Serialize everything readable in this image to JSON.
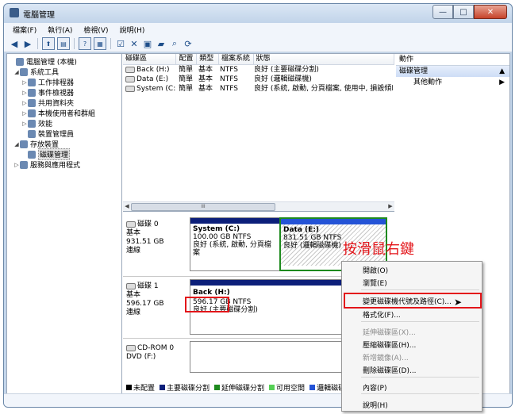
{
  "window": {
    "title": "電腦管理",
    "min": "—",
    "max": "□",
    "close": "✕"
  },
  "menu": [
    "檔案(F)",
    "執行(A)",
    "檢視(V)",
    "說明(H)"
  ],
  "tree": [
    {
      "label": "電腦管理 (本機)",
      "depth": 0,
      "exp": ""
    },
    {
      "label": "系統工具",
      "depth": 1,
      "exp": "◢"
    },
    {
      "label": "工作排程器",
      "depth": 2,
      "exp": "▷"
    },
    {
      "label": "事件檢視器",
      "depth": 2,
      "exp": "▷"
    },
    {
      "label": "共用資料夾",
      "depth": 2,
      "exp": "▷"
    },
    {
      "label": "本機使用者和群組",
      "depth": 2,
      "exp": "▷"
    },
    {
      "label": "效能",
      "depth": 2,
      "exp": "▷"
    },
    {
      "label": "裝置管理員",
      "depth": 2,
      "exp": ""
    },
    {
      "label": "存放裝置",
      "depth": 1,
      "exp": "◢"
    },
    {
      "label": "磁碟管理",
      "depth": 2,
      "exp": "",
      "selected": true
    },
    {
      "label": "服務與應用程式",
      "depth": 1,
      "exp": "▷"
    }
  ],
  "list": {
    "headers": [
      "磁碟區",
      "配置",
      "類型",
      "檔案系統",
      "狀態"
    ],
    "rows": [
      [
        "Back (H:)",
        "簡單",
        "基本",
        "NTFS",
        "良好 (主要磁碟分割)"
      ],
      [
        "Data (E:)",
        "簡單",
        "基本",
        "NTFS",
        "良好 (邏輯磁碟機)"
      ],
      [
        "System (C:)",
        "簡單",
        "基本",
        "NTFS",
        "良好 (系統, 啟動, 分頁檔案, 使用中, 損毀傾印,"
      ]
    ],
    "scroll_label": "III"
  },
  "disks": {
    "disk0": {
      "name": "磁碟 0",
      "type": "基本",
      "size": "931.51 GB",
      "status": "連線"
    },
    "disk0_p1": {
      "name": "System (C:)",
      "size": "100.00 GB NTFS",
      "status": "良好 (系統, 啟動, 分頁檔案"
    },
    "disk0_p2": {
      "name": "Data (E:)",
      "size": "831.51 GB NTFS",
      "status": "良好 (邏輯磁碟機)"
    },
    "disk1": {
      "name": "磁碟 1",
      "type": "基本",
      "size": "596.17 GB",
      "status": "連線"
    },
    "disk1_p1": {
      "name": "Back (H:)",
      "size": "596.17 GB NTFS",
      "status": "良好 (主要磁碟分割)"
    },
    "cdrom": {
      "name": "CD-ROM 0",
      "drive": "DVD (F:)"
    }
  },
  "legend": [
    {
      "label": "未配置",
      "color": "#000000"
    },
    {
      "label": "主要磁碟分割",
      "color": "#0c1f7a"
    },
    {
      "label": "延伸磁碟分割",
      "color": "#1e8a1e"
    },
    {
      "label": "可用空間",
      "color": "#55d055"
    },
    {
      "label": "邏輯磁碟",
      "color": "#2453d6"
    }
  ],
  "actions": {
    "header": "動作",
    "section": "磁碟管理",
    "item": "其他動作"
  },
  "context_menu": [
    {
      "label": "開啟(O)",
      "disabled": false
    },
    {
      "label": "瀏覽(E)",
      "disabled": false
    },
    {
      "label": "變更磁碟機代號及路徑(C)...",
      "disabled": false,
      "highlight": true
    },
    {
      "label": "格式化(F)...",
      "disabled": false
    },
    {
      "label": "延伸磁碟區(X)...",
      "disabled": true
    },
    {
      "label": "壓縮磁碟區(H)...",
      "disabled": false
    },
    {
      "label": "新增鏡像(A)...",
      "disabled": true
    },
    {
      "label": "刪除磁碟區(D)...",
      "disabled": false
    },
    {
      "label": "內容(P)",
      "disabled": false
    },
    {
      "label": "說明(H)",
      "disabled": false
    }
  ],
  "annotation": "按滑鼠右鍵",
  "icons": {
    "cursor": "arrow-cursor-icon",
    "collapse": "▲",
    "submenu": "▶"
  }
}
